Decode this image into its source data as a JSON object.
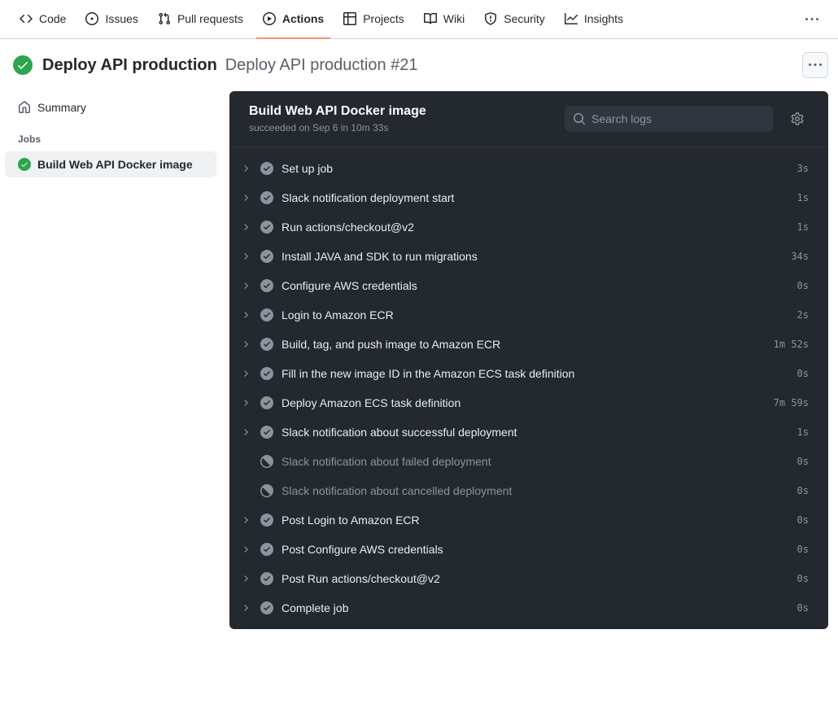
{
  "nav": {
    "tabs": [
      {
        "label": "Code"
      },
      {
        "label": "Issues"
      },
      {
        "label": "Pull requests"
      },
      {
        "label": "Actions"
      },
      {
        "label": "Projects"
      },
      {
        "label": "Wiki"
      },
      {
        "label": "Security"
      },
      {
        "label": "Insights"
      }
    ]
  },
  "title": {
    "name": "Deploy API production",
    "run": "Deploy API production #21"
  },
  "sidebar": {
    "summary": "Summary",
    "jobs_label": "Jobs",
    "job_name": "Build Web API Docker image"
  },
  "log": {
    "job_title": "Build Web API Docker image",
    "job_sub": "succeeded on Sep 6 in 10m 33s",
    "search_placeholder": "Search logs",
    "steps": [
      {
        "name": "Set up job",
        "dur": "3s",
        "status": "ok"
      },
      {
        "name": "Slack notification deployment start",
        "dur": "1s",
        "status": "ok"
      },
      {
        "name": "Run actions/checkout@v2",
        "dur": "1s",
        "status": "ok"
      },
      {
        "name": "Install JAVA and SDK to run migrations",
        "dur": "34s",
        "status": "ok"
      },
      {
        "name": "Configure AWS credentials",
        "dur": "0s",
        "status": "ok"
      },
      {
        "name": "Login to Amazon ECR",
        "dur": "2s",
        "status": "ok"
      },
      {
        "name": "Build, tag, and push image to Amazon ECR",
        "dur": "1m 52s",
        "status": "ok"
      },
      {
        "name": "Fill in the new image ID in the Amazon ECS task definition",
        "dur": "0s",
        "status": "ok"
      },
      {
        "name": "Deploy Amazon ECS task definition",
        "dur": "7m 59s",
        "status": "ok"
      },
      {
        "name": "Slack notification about successful deployment",
        "dur": "1s",
        "status": "ok"
      },
      {
        "name": "Slack notification about failed deployment",
        "dur": "0s",
        "status": "skipped"
      },
      {
        "name": "Slack notification about cancelled deployment",
        "dur": "0s",
        "status": "skipped"
      },
      {
        "name": "Post Login to Amazon ECR",
        "dur": "0s",
        "status": "ok"
      },
      {
        "name": "Post Configure AWS credentials",
        "dur": "0s",
        "status": "ok"
      },
      {
        "name": "Post Run actions/checkout@v2",
        "dur": "0s",
        "status": "ok"
      },
      {
        "name": "Complete job",
        "dur": "0s",
        "status": "ok"
      }
    ]
  }
}
